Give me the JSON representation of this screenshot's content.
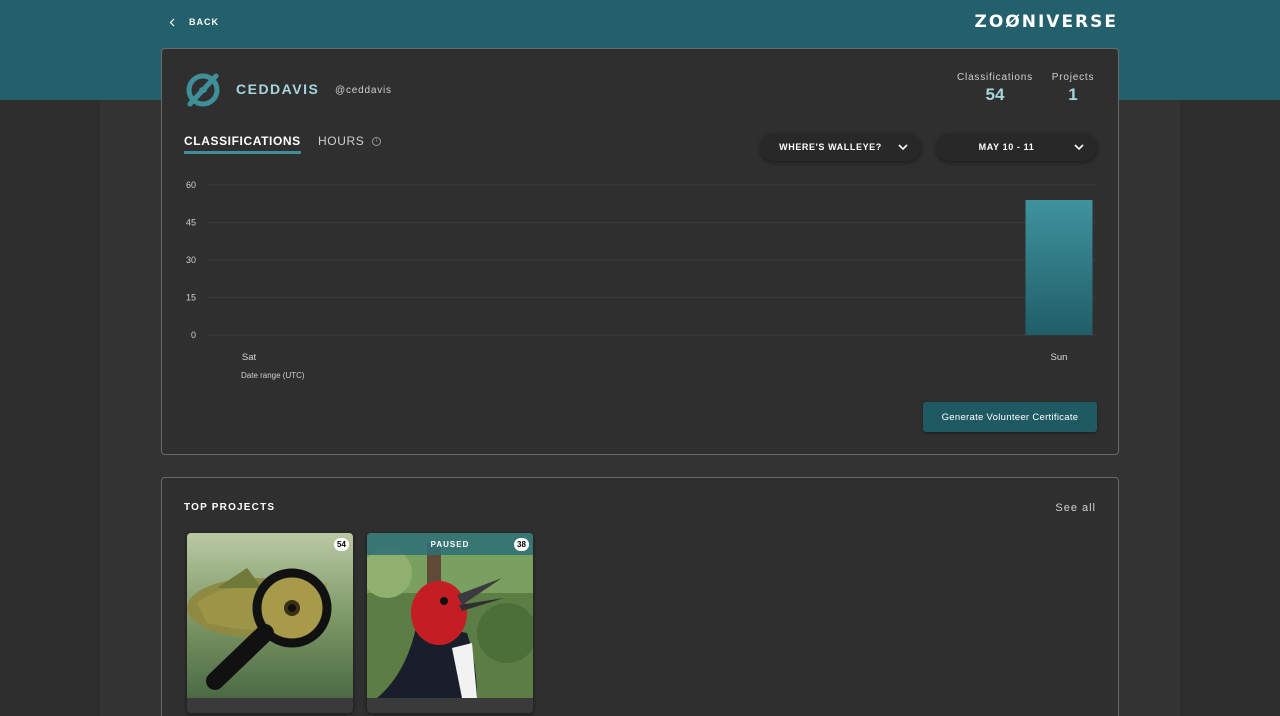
{
  "header": {
    "back_label": "BACK",
    "logo_text": "ZOØNIVERSE"
  },
  "profile": {
    "display_name": "CEDDAVIS",
    "login": "@ceddavis",
    "stats": {
      "classifications_label": "Classifications",
      "classifications_value": "54",
      "projects_label": "Projects",
      "projects_value": "1"
    }
  },
  "tabs": {
    "classifications": "CLASSIFICATIONS",
    "hours": "HOURS"
  },
  "filters": {
    "project": "WHERE'S WALLEYE?",
    "date_range": "MAY 10 - 11"
  },
  "chart_data": {
    "type": "bar",
    "categories": [
      "Sat",
      "Sun"
    ],
    "values": [
      0,
      54
    ],
    "ylim": [
      0,
      60
    ],
    "yticks": [
      0,
      15,
      30,
      45,
      60
    ],
    "xlabel": "Date range (UTC)",
    "ylabel": "",
    "title": "",
    "grid": true,
    "bar_color": "#3a8a96"
  },
  "actions": {
    "certificate_label": "Generate Volunteer Certificate"
  },
  "top_projects": {
    "title": "TOP PROJECTS",
    "see_all": "See all",
    "items": [
      {
        "count": "54",
        "status": ""
      },
      {
        "count": "38",
        "status": "PAUSED"
      }
    ]
  },
  "colors": {
    "brand": "#23606c",
    "accent": "#a5d6dc",
    "button": "#1f5a63"
  }
}
